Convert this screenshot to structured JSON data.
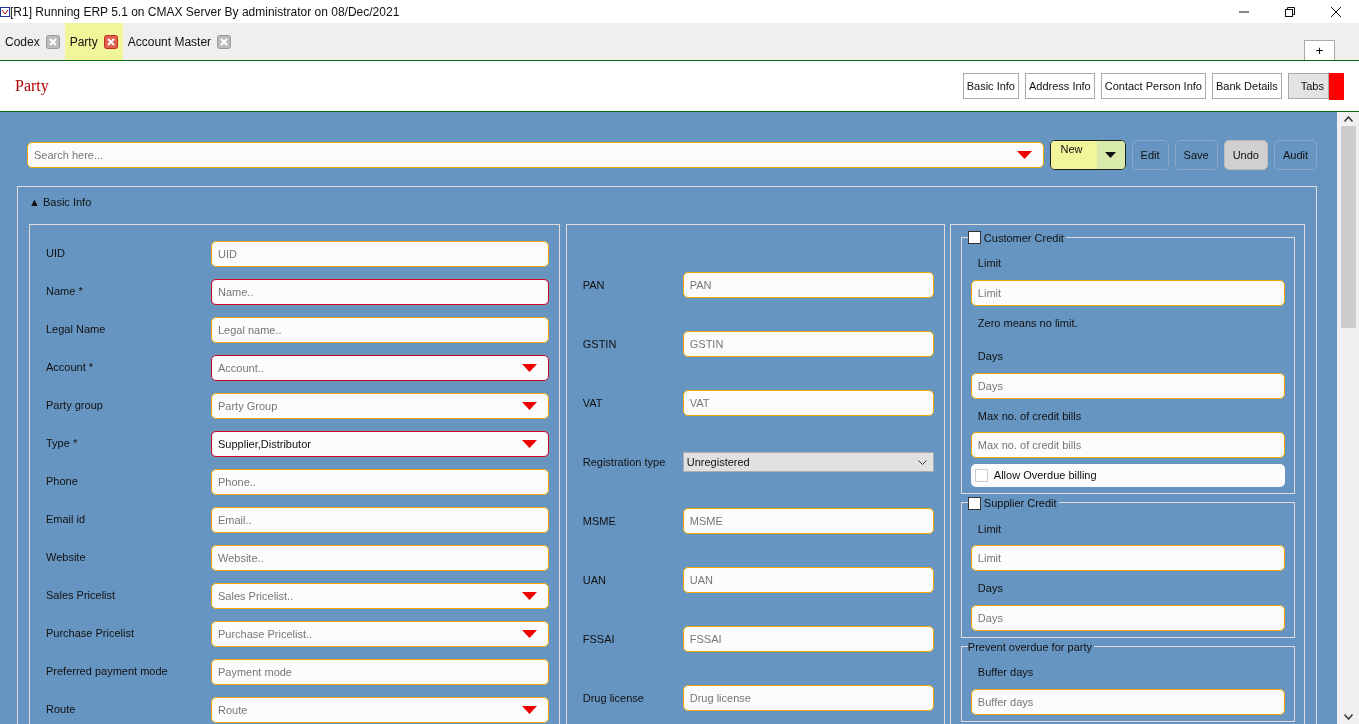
{
  "window": {
    "title": "[R1] Running ERP 5.1 on CMAX Server By administrator on 08/Dec/2021"
  },
  "tabs": [
    {
      "label": "Codex",
      "selected": false
    },
    {
      "label": "Party",
      "selected": true
    },
    {
      "label": "Account Master",
      "selected": false
    }
  ],
  "add_tab": "+",
  "page": {
    "title": "Party",
    "nav_buttons": [
      {
        "label": "Basic Info",
        "selected": false
      },
      {
        "label": "Address Info",
        "selected": false
      },
      {
        "label": "Contact Person Info",
        "selected": false
      },
      {
        "label": "Bank Details",
        "selected": false
      },
      {
        "label": "Tabs",
        "selected": true
      }
    ]
  },
  "toolbar": {
    "search": {
      "placeholder": "Search here..."
    },
    "new_button": "New",
    "buttons": [
      {
        "label": "Edit",
        "disabled": false
      },
      {
        "label": "Save",
        "disabled": false
      },
      {
        "label": "Undo",
        "disabled": true
      },
      {
        "label": "Audit",
        "disabled": false
      }
    ]
  },
  "section": {
    "title": "Basic Info",
    "toggle": "▲",
    "expanded": true
  },
  "column_1": [
    {
      "label": "UID",
      "kind": "text",
      "placeholder": "UID",
      "required": false
    },
    {
      "label": "Name *",
      "kind": "text",
      "placeholder": "Name..",
      "required": true
    },
    {
      "label": "Legal Name",
      "kind": "text",
      "placeholder": "Legal name..",
      "required": false
    },
    {
      "label": "Account *",
      "kind": "dropdown",
      "placeholder": "Account..",
      "required": true
    },
    {
      "label": "Party group",
      "kind": "dropdown",
      "placeholder": "Party Group",
      "required": false
    },
    {
      "label": "Type *",
      "kind": "dropdown",
      "value": "Supplier,Distributor",
      "required": true
    },
    {
      "label": "Phone",
      "kind": "text",
      "placeholder": "Phone..",
      "required": false
    },
    {
      "label": "Email id",
      "kind": "text",
      "placeholder": "Email..",
      "required": false
    },
    {
      "label": "Website",
      "kind": "text",
      "placeholder": "Website..",
      "required": false
    },
    {
      "label": "Sales Pricelist",
      "kind": "dropdown",
      "placeholder": "Sales Pricelist..",
      "required": false
    },
    {
      "label": "Purchase Pricelist",
      "kind": "dropdown",
      "placeholder": "Purchase Pricelist..",
      "required": false
    },
    {
      "label": "Preferred payment mode",
      "kind": "text",
      "placeholder": "Payment mode",
      "required": false
    },
    {
      "label": "Route",
      "kind": "dropdown",
      "placeholder": "Route",
      "required": false
    }
  ],
  "column_2": [
    {
      "label": "PAN",
      "kind": "text",
      "placeholder": "PAN"
    },
    {
      "label": "GSTIN",
      "kind": "text",
      "placeholder": "GSTIN"
    },
    {
      "label": "VAT",
      "kind": "text",
      "placeholder": "VAT"
    },
    {
      "label": "Registration type",
      "kind": "select",
      "value": "Unregistered"
    },
    {
      "label": "MSME",
      "kind": "text",
      "placeholder": "MSME"
    },
    {
      "label": "UAN",
      "kind": "text",
      "placeholder": "UAN"
    },
    {
      "label": "FSSAI",
      "kind": "text",
      "placeholder": "FSSAI"
    },
    {
      "label": "Drug license",
      "kind": "text",
      "placeholder": "Drug license"
    }
  ],
  "column_3": [
    {
      "title": "Customer Credit",
      "checked": false,
      "items": [
        {
          "kind": "label",
          "text": "Limit"
        },
        {
          "kind": "input",
          "placeholder": "Limit"
        },
        {
          "kind": "label",
          "text": "Zero means no limit."
        },
        {
          "kind": "label",
          "text": "Days"
        },
        {
          "kind": "input",
          "placeholder": "Days"
        },
        {
          "kind": "label",
          "text": "Max no. of credit bills"
        },
        {
          "kind": "input",
          "placeholder": "Max no. of credit bills"
        },
        {
          "kind": "checkbox",
          "text": "Allow Overdue billing",
          "checked": false
        }
      ]
    },
    {
      "title": "Supplier Credit",
      "checked": false,
      "items": [
        {
          "kind": "label",
          "text": "Limit"
        },
        {
          "kind": "input",
          "placeholder": "Limit"
        },
        {
          "kind": "label",
          "text": "Days"
        },
        {
          "kind": "input",
          "placeholder": "Days"
        }
      ]
    },
    {
      "title": "Prevent overdue for party",
      "items": [
        {
          "kind": "label",
          "text": "Buffer days"
        },
        {
          "kind": "input",
          "placeholder": "Buffer days"
        }
      ]
    }
  ]
}
